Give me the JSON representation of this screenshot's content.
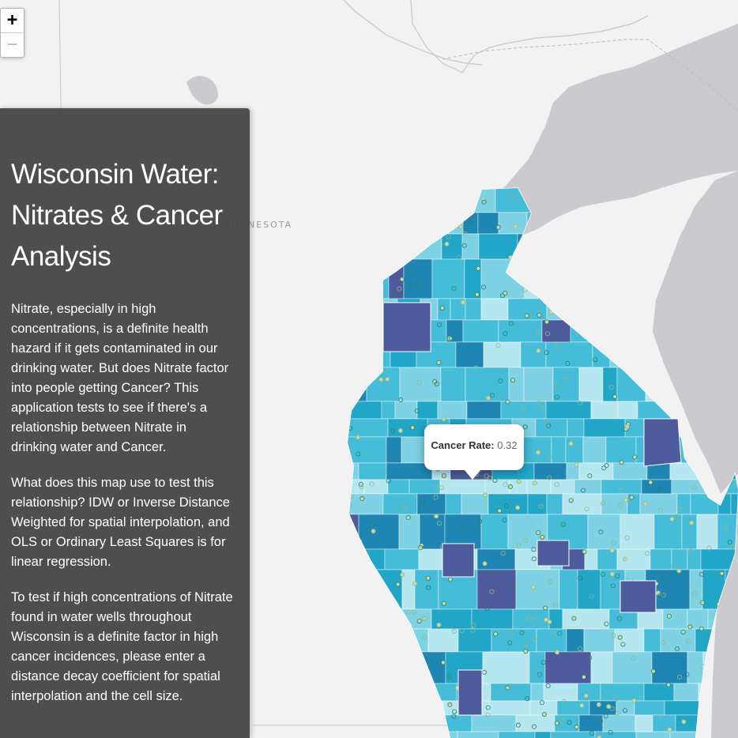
{
  "zoom": {
    "in_label": "+",
    "out_label": "−"
  },
  "map": {
    "place_label": "MINNESOTA",
    "colors": {
      "land": "#f2f2f2",
      "water": "#cbcbcf",
      "border": "#c8c8c8",
      "tract_palette": [
        "#b6e6f0",
        "#7fd2e4",
        "#45bcd8",
        "#22a6c8",
        "#1f86b3",
        "#4d5a9c"
      ]
    },
    "popup": {
      "label": "Cancer Rate:",
      "value": "0.32"
    }
  },
  "panel": {
    "title": "Wisconsin Water: Nitrates & Cancer Analysis",
    "paragraphs": [
      "Nitrate, especially in high concentrations, is a definite health hazard if it gets contaminated in our drinking water. But does Nitrate factor into people getting Cancer? This application tests to see if there's a relationship between Nitrate in drinking water and Cancer.",
      "What does this map use to test this relationship? IDW or Inverse Distance Weighted for spatial interpolation, and OLS or Ordinary Least Squares is for linear regression.",
      "To test if high concentrations of Nitrate found in water wells throughout Wisconsin is a definite factor in high cancer incidences, please enter a distance decay coefficient for spatial interpolation and the cell size."
    ],
    "background": "#484848"
  }
}
